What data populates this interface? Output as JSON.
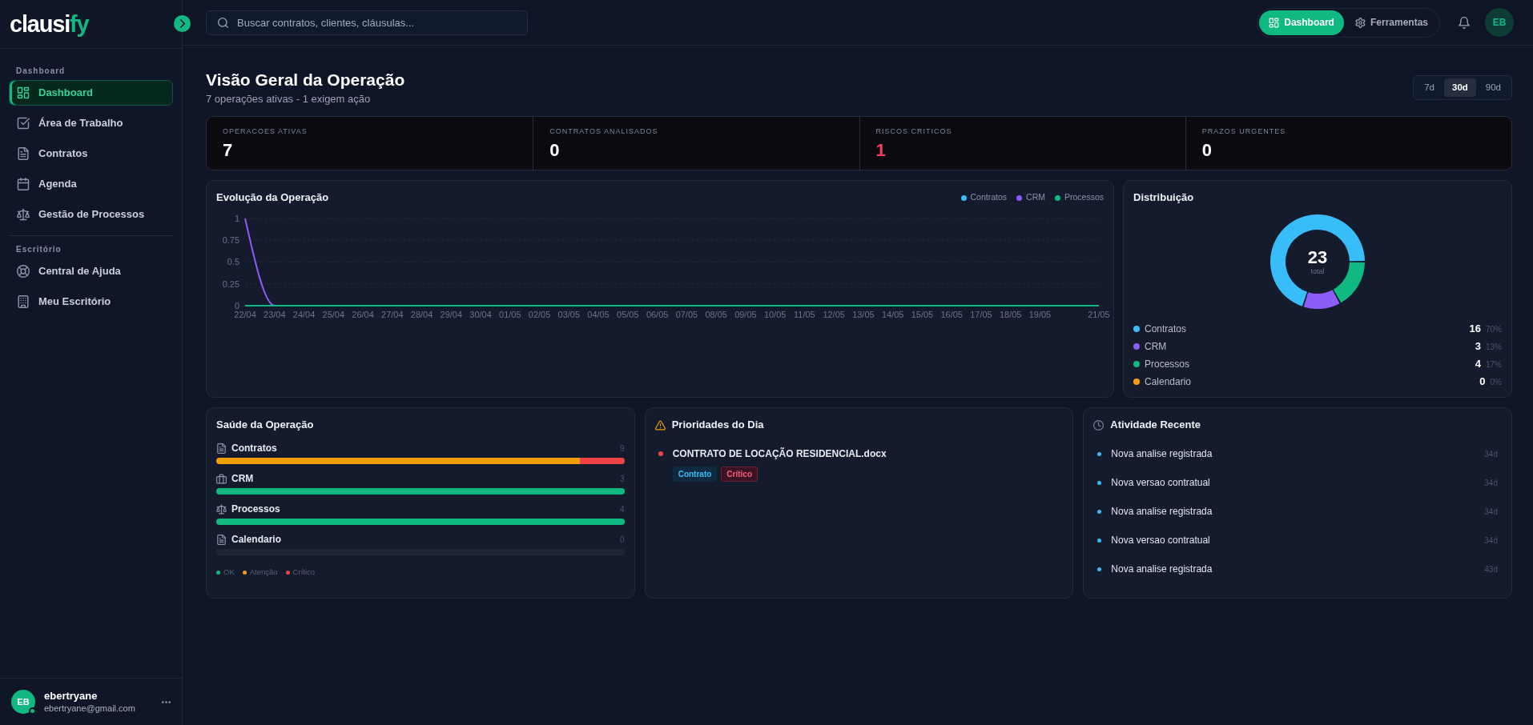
{
  "sidebar": {
    "logo": {
      "main": "clausi",
      "accent": "fy"
    },
    "sections": [
      {
        "title": "Dashboard",
        "items": [
          {
            "label": "Dashboard",
            "selected": true
          },
          {
            "label": "Área de Trabalho",
            "selected": false
          },
          {
            "label": "Contratos",
            "selected": false
          },
          {
            "label": "Agenda",
            "selected": false
          },
          {
            "label": "Gestão de Processos",
            "selected": false
          }
        ]
      },
      {
        "title": "Escritório",
        "items": [
          {
            "label": "Central de Ajuda",
            "selected": false
          },
          {
            "label": "Meu Escritório",
            "selected": false
          }
        ]
      }
    ],
    "user": {
      "initials": "EB",
      "name": "ebertryane",
      "email": "ebertryane@gmail.com",
      "online": true
    }
  },
  "header": {
    "search": {
      "placeholder": "Buscar contratos, clientes, cláusulas..."
    },
    "tabs": [
      {
        "label": "Dashboard",
        "selected": true
      },
      {
        "label": "Ferramentas",
        "selected": false
      }
    ],
    "avatar": "EB"
  },
  "page": {
    "title": "Visão Geral da Operação",
    "subtitle": "7 operações ativas - 1 exigem ação",
    "periods": [
      {
        "label": "7d",
        "selected": false
      },
      {
        "label": "30d",
        "selected": true
      },
      {
        "label": "90d",
        "selected": false
      }
    ]
  },
  "stats": [
    {
      "label": "OPERACOES ATIVAS",
      "value": "7",
      "critical": false
    },
    {
      "label": "CONTRATOS ANALISADOS",
      "value": "0",
      "critical": false
    },
    {
      "label": "RISCOS CRITICOS",
      "value": "1",
      "critical": true
    },
    {
      "label": "PRAZOS URGENTES",
      "value": "0",
      "critical": false
    }
  ],
  "evolution": {
    "title": "Evolução da Operação",
    "chart_data": {
      "type": "line",
      "grid": true,
      "categories": [
        "22/04",
        "23/04",
        "24/04",
        "25/04",
        "26/04",
        "27/04",
        "28/04",
        "29/04",
        "30/04",
        "01/05",
        "02/05",
        "03/05",
        "04/05",
        "05/05",
        "06/05",
        "07/05",
        "08/05",
        "09/05",
        "10/05",
        "11/05",
        "12/05",
        "13/05",
        "14/05",
        "15/05",
        "16/05",
        "17/05",
        "18/05",
        "19/05",
        null,
        "21/05"
      ],
      "ylim": [
        0,
        1
      ],
      "yticks": [
        0,
        0.25,
        0.5,
        0.75,
        1
      ],
      "series": [
        {
          "name": "Contratos",
          "color": "#38bdf8",
          "values": [
            null,
            null,
            null,
            null,
            null,
            null,
            null,
            null,
            null,
            null,
            null,
            null,
            null,
            null,
            null,
            null,
            null,
            null,
            null,
            null,
            null,
            null,
            null,
            null,
            null,
            null,
            null,
            null,
            null,
            null
          ]
        },
        {
          "name": "CRM",
          "color": "#8b5cf6",
          "values": [
            1,
            0,
            null,
            null,
            null,
            null,
            null,
            null,
            null,
            null,
            null,
            null,
            null,
            null,
            null,
            null,
            null,
            null,
            null,
            null,
            null,
            null,
            null,
            null,
            null,
            null,
            null,
            null,
            null,
            null
          ]
        },
        {
          "name": "Processos",
          "color": "#10b981",
          "values": [
            0,
            0,
            0,
            0,
            0,
            0,
            0,
            0,
            0,
            0,
            0,
            0,
            0,
            0,
            0,
            0,
            0,
            0,
            0,
            0,
            0,
            0,
            0,
            0,
            0,
            0,
            0,
            0,
            0,
            0
          ]
        }
      ]
    }
  },
  "distribution": {
    "title": "Distribuição",
    "center_value": "23",
    "center_label": "total",
    "chart_data": {
      "type": "donut",
      "categories": [
        "Contratos",
        "CRM",
        "Processos",
        "Calendario"
      ],
      "values": [
        70,
        13,
        17,
        0
      ]
    },
    "legend": [
      {
        "count": "16",
        "percent": "70%",
        "color": "#38bdf8"
      },
      {
        "count": "3",
        "percent": "13%",
        "color": "#8b5cf6"
      },
      {
        "count": "4",
        "percent": "17%",
        "color": "#10b981"
      },
      {
        "count": "0",
        "percent": "0%",
        "color": "#f59e0b"
      }
    ]
  },
  "health": {
    "title": "Saúde da Operação",
    "items": [
      {
        "label": "Contratos",
        "count": "9",
        "segments": [
          {
            "kind": "attention",
            "level": 0.89
          },
          {
            "kind": "critical",
            "level": 0.11
          }
        ]
      },
      {
        "label": "CRM",
        "count": "3",
        "segments": [
          {
            "kind": "ok",
            "level": 1
          }
        ]
      },
      {
        "label": "Processos",
        "count": "4",
        "segments": [
          {
            "kind": "ok",
            "level": 1
          }
        ]
      },
      {
        "label": "Calendario",
        "count": "0"
      }
    ],
    "legend": [
      {
        "kind": "ok",
        "label": "OK",
        "color": "#10b981"
      },
      {
        "kind": "attention",
        "label": "Atenção",
        "color": "#f59e0b"
      },
      {
        "kind": "critical",
        "label": "Crítico",
        "color": "#ef4444"
      }
    ]
  },
  "priorities": {
    "title": "Prioridades do Dia",
    "items": [
      {
        "title": "CONTRATO DE LOCAÇÃO RESIDENCIAL.docx",
        "color": "#ef4444",
        "tags": [
          {
            "label": "Contrato",
            "kind": "type"
          },
          {
            "label": "Crítico",
            "kind": "severity"
          }
        ]
      }
    ]
  },
  "activity": {
    "title": "Atividade Recente",
    "items": [
      {
        "text": "Nova analise registrada",
        "time": "34d"
      },
      {
        "text": "Nova versao contratual",
        "time": "34d"
      },
      {
        "text": "Nova analise registrada",
        "time": "34d"
      },
      {
        "text": "Nova versao contratual",
        "time": "34d"
      },
      {
        "text": "Nova analise registrada",
        "time": "43d"
      }
    ]
  }
}
